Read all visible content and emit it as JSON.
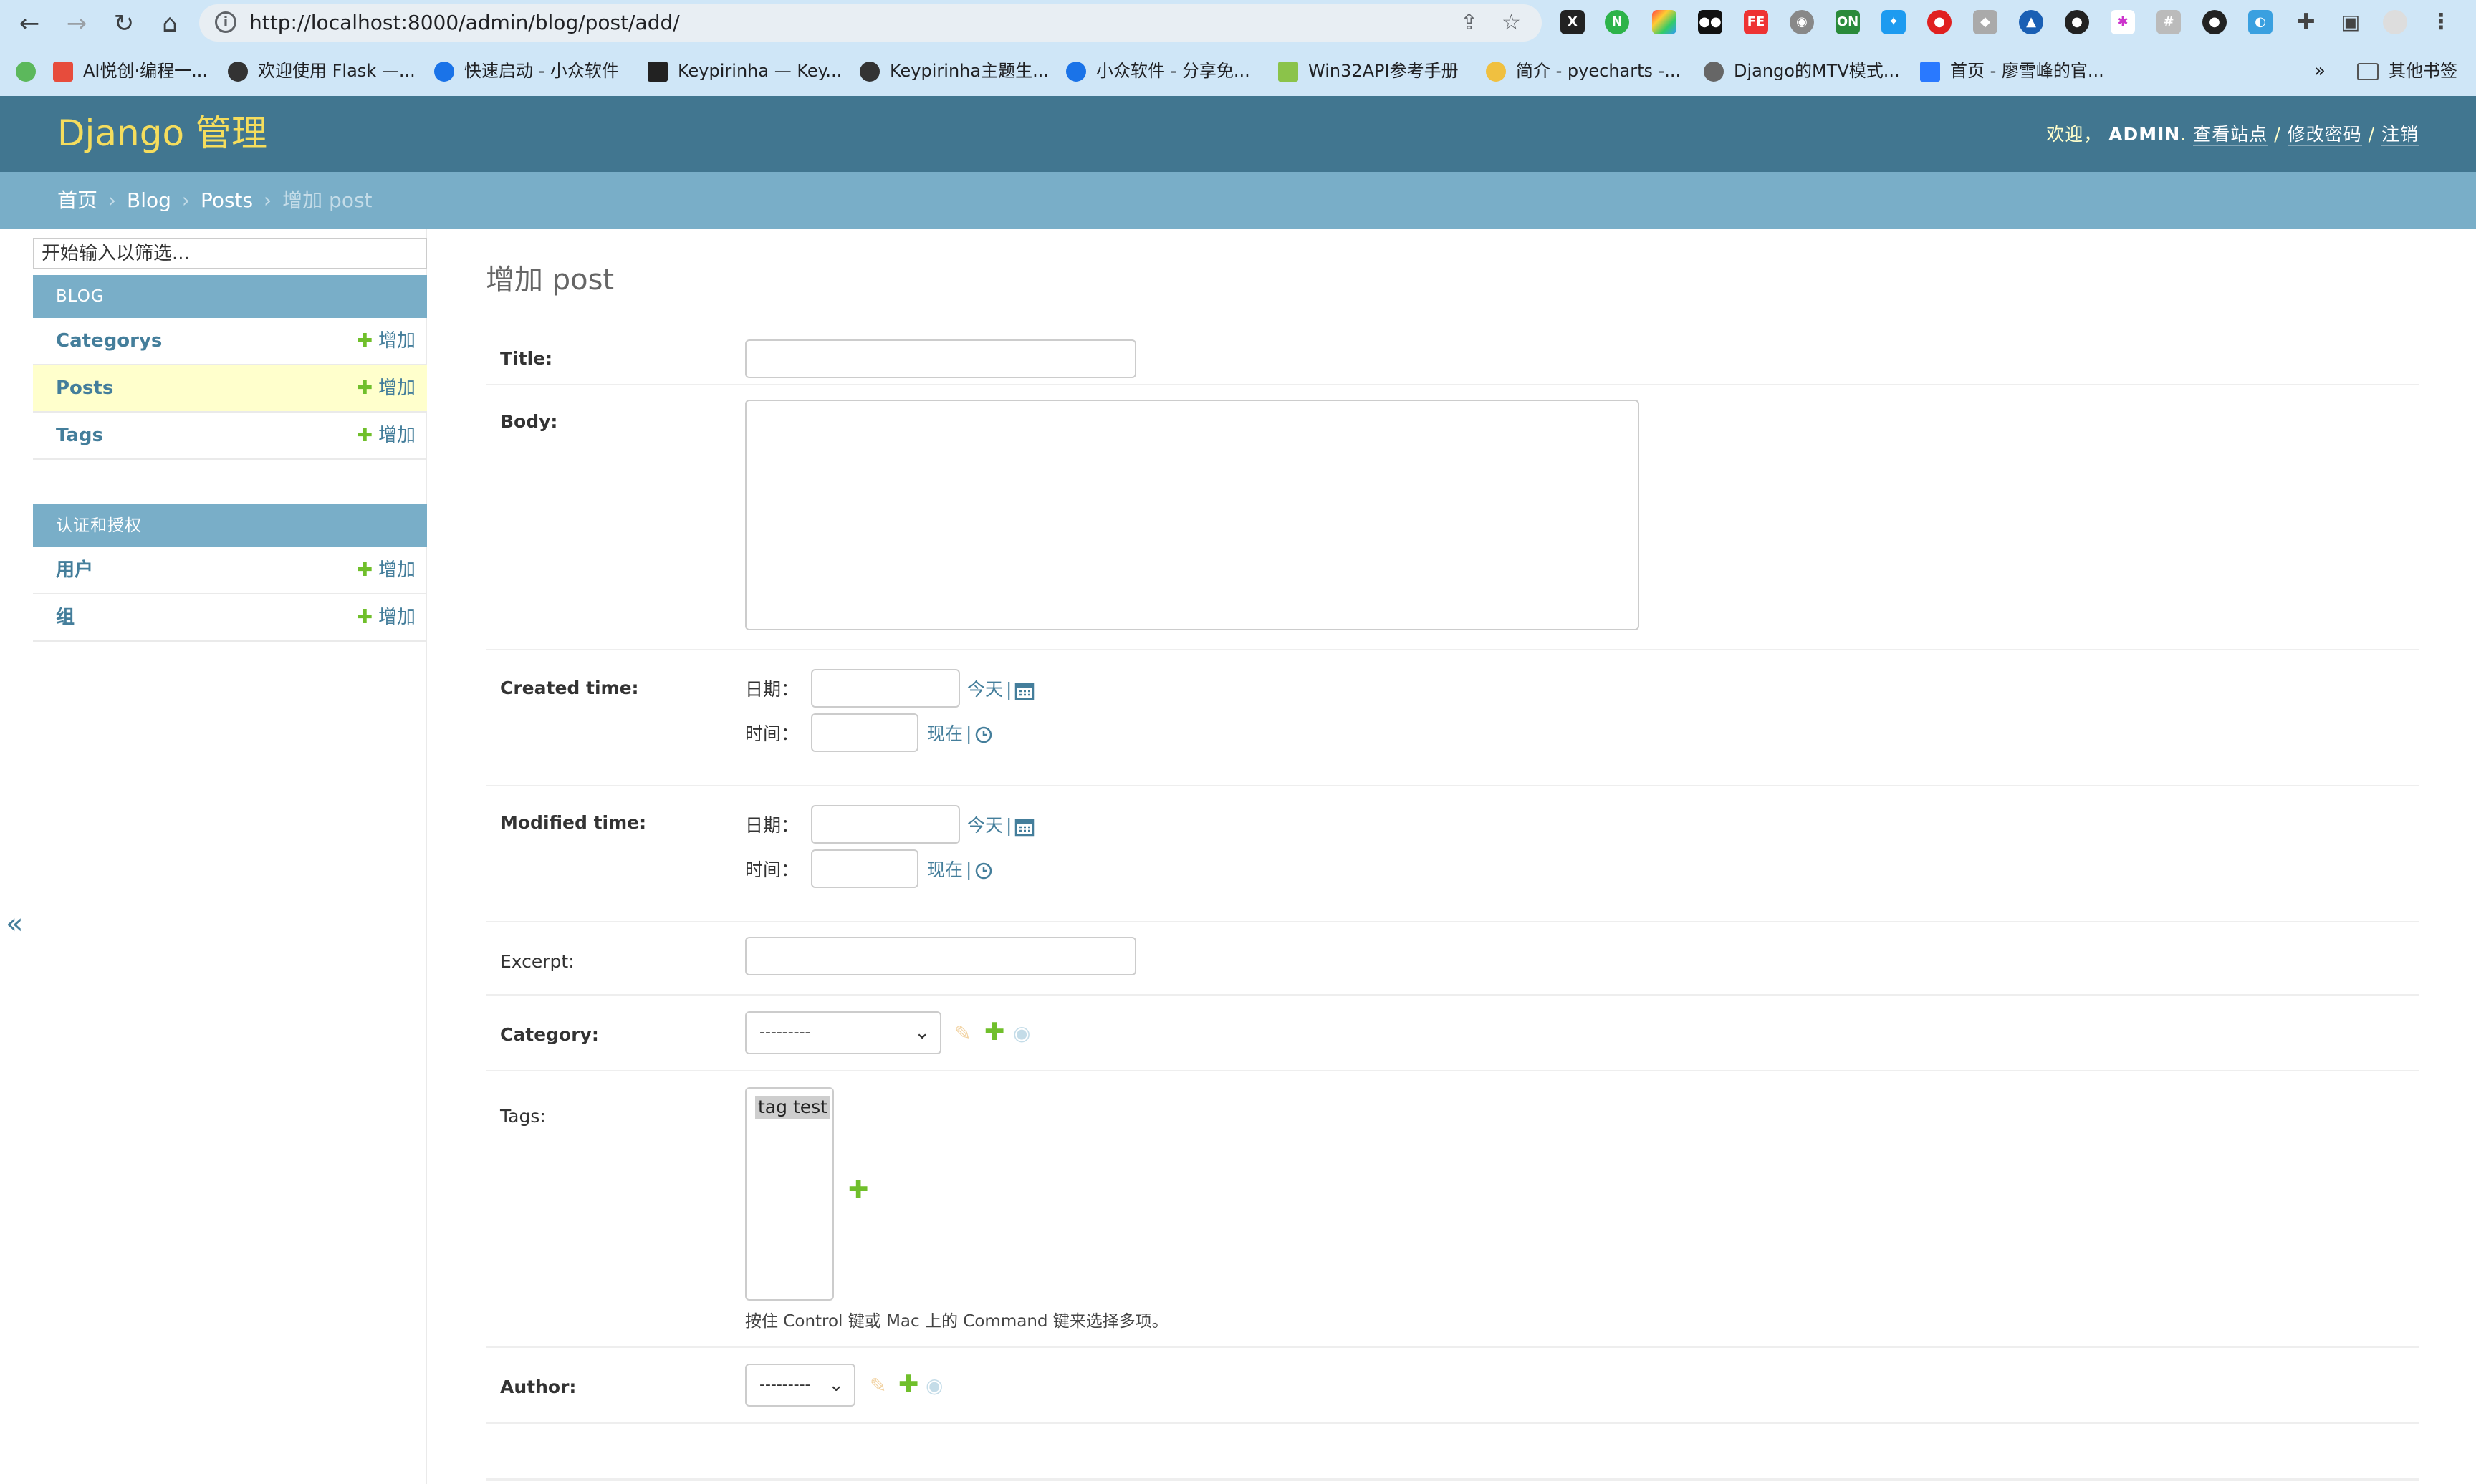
{
  "browser": {
    "url": "http://localhost:8000/admin/blog/post/add/",
    "bookmarks": [
      "AI悦创·编程一...",
      "欢迎使用 Flask —...",
      "快速启动 - 小众软件",
      "Keypirinha — Key...",
      "Keypirinha主题生...",
      "小众软件 - 分享免...",
      "Win32API参考手册",
      "简介 - pyecharts -...",
      "Django的MTV模式...",
      "首页 - 廖雪峰的官..."
    ],
    "bookmarks_more": "»",
    "other_bookmarks": "其他书签"
  },
  "header": {
    "branding": "Django 管理",
    "welcome": "欢迎，",
    "username": "ADMIN",
    "view_site": "查看站点",
    "change_password": "修改密码",
    "logout": "注销",
    "sep": "/"
  },
  "breadcrumbs": {
    "home": "首页",
    "app": "Blog",
    "model": "Posts",
    "current": "增加 post",
    "sep": "›"
  },
  "sidebar": {
    "filter_placeholder": "开始输入以筛选...",
    "collapse": "«",
    "modules": [
      {
        "caption": "BLOG",
        "items": [
          {
            "label": "Categorys",
            "add": "增加"
          },
          {
            "label": "Posts",
            "add": "增加"
          },
          {
            "label": "Tags",
            "add": "增加"
          }
        ]
      },
      {
        "caption": "认证和授权",
        "items": [
          {
            "label": "用户",
            "add": "增加"
          },
          {
            "label": "组",
            "add": "增加"
          }
        ]
      }
    ]
  },
  "form": {
    "title": "增加 post",
    "fields": {
      "title": {
        "label": "Title:",
        "value": ""
      },
      "body": {
        "label": "Body:",
        "value": ""
      },
      "created_time": {
        "label": "Created time:",
        "date_label": "日期：",
        "time_label": "时间：",
        "today": "今天",
        "now": "现在",
        "bar": "|"
      },
      "modified_time": {
        "label": "Modified time:",
        "date_label": "日期：",
        "time_label": "时间：",
        "today": "今天",
        "now": "现在",
        "bar": "|"
      },
      "excerpt": {
        "label": "Excerpt:",
        "value": ""
      },
      "category": {
        "label": "Category:",
        "selected": "---------"
      },
      "tags": {
        "label": "Tags:",
        "options": [
          "tag test"
        ],
        "help": "按住 Control 键或 Mac 上的 Command 键来选择多项。"
      },
      "author": {
        "label": "Author:",
        "selected": "---------"
      }
    }
  },
  "colors": {
    "header": "#417690",
    "breadcrumbs": "#79aec8",
    "branding": "#f5dd5d",
    "link": "#447e9b",
    "add": "#70bf2b",
    "current_row": "#ffffcc"
  }
}
